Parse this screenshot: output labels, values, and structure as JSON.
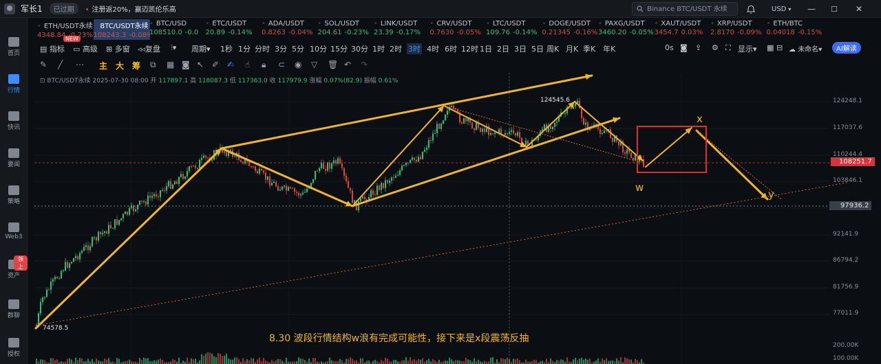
{
  "titlebar": {
    "user_name": "军长1",
    "status_badge": "已过期",
    "promo_text": "注册返20%，赢迈凯伦乐高",
    "search_placeholder": "Binance BTC/USDT 永续",
    "currency": "USD"
  },
  "sidebar": {
    "items": [
      {
        "label": "首页"
      },
      {
        "label": "行情"
      },
      {
        "label": "快讯"
      },
      {
        "label": "要闻"
      },
      {
        "label": "策略"
      },
      {
        "label": "Web3"
      },
      {
        "label": "资产",
        "badge": "领上"
      },
      {
        "label": "群聊"
      },
      {
        "label": "授权"
      }
    ]
  },
  "tickers": [
    {
      "pair": "ETH/USDT永续",
      "price": "4348.84",
      "change": "-0.23%",
      "dir": "down"
    },
    {
      "pair": "BTC/USDT永续",
      "price": "108243.3",
      "change": "-0.08%",
      "dir": "down",
      "active": true
    },
    {
      "pair": "BTC/USD",
      "price": "108510.0",
      "change": "-0.0",
      "dir": "up"
    },
    {
      "pair": "ETC/USDT",
      "price": "20.89",
      "change": "-0.14%",
      "dir": "up"
    },
    {
      "pair": "ADA/USDT",
      "price": "0.8263",
      "change": "-0.04%",
      "dir": "down"
    },
    {
      "pair": "SOL/USDT",
      "price": "204.61",
      "change": "-0.23%",
      "dir": "up"
    },
    {
      "pair": "LINK/USDT",
      "price": "23.39",
      "change": "-0.17%",
      "dir": "up"
    },
    {
      "pair": "CRV/USDT",
      "price": "0.7630",
      "change": "-0.05%",
      "dir": "down"
    },
    {
      "pair": "LTC/USDT",
      "price": "109.76",
      "change": "-0.14%",
      "dir": "up"
    },
    {
      "pair": "DOGE/USDT",
      "price": "0.21345",
      "change": "-0.16%",
      "dir": "down"
    },
    {
      "pair": "PAXG/USDT",
      "price": "3460.20",
      "change": "-0.05%",
      "dir": "up"
    },
    {
      "pair": "XAUT/USDT",
      "price": "3454.7",
      "change": "0.03%",
      "dir": "down"
    },
    {
      "pair": "XRP/USDT",
      "price": "2.8170",
      "change": "-0.09%",
      "dir": "down"
    },
    {
      "pair": "ETH/BTC",
      "price": "0.04018",
      "change": "-0.15%",
      "dir": "down"
    }
  ],
  "new_badge": "NEW",
  "toolbar": {
    "left": [
      "指标",
      "高级",
      "多窗",
      "复盘"
    ],
    "period_label": "周期",
    "timeframes": [
      "1秒",
      "1分",
      "分时",
      "3分",
      "5分",
      "10分",
      "15分",
      "30分",
      "1时",
      "2时",
      "3时",
      "4时",
      "6时",
      "12时",
      "1日",
      "2日",
      "3日",
      "5日",
      "周K",
      "月K",
      "季K",
      "年K"
    ],
    "active_timeframe": "3时",
    "seconds": "0s",
    "display_label": "显示",
    "unnamed_label": "未命名",
    "ai_label": "AI解读"
  },
  "drawbar": {
    "gold_tools": [
      "主",
      "大",
      "筹"
    ]
  },
  "chart_info": {
    "symbol": "BTC/USDT永续",
    "date": "2025-07-30 08:00",
    "open_label": "开",
    "open": "117897.1",
    "high_label": "高",
    "high": "118087.3",
    "low_label": "低",
    "low": "117363.0",
    "close_label": "收",
    "close": "117979.9",
    "change_label": "涨幅",
    "change": "0.07%(82.9)",
    "amp_label": "振幅",
    "amp": "0.61%"
  },
  "chart_data": {
    "type": "line",
    "price_axis_ticks": [
      "124248.1",
      "117037.6",
      "110244.4",
      "103846.1",
      "97936.2",
      "92141.9",
      "86794.2",
      "81756.9",
      "77011.9",
      "200.00K",
      "100.00K"
    ],
    "current_price": "108251.7",
    "crosshair_price": "97936.2",
    "high_label": "124545.6",
    "low_label": "74578.5",
    "wave_labels": [
      "w",
      "x",
      "y"
    ],
    "annotation": "8.30 波段行情结构w浪有完成可能性，接下来是x段震荡反抽",
    "colors": {
      "up": "#27c47a",
      "down": "#e04545",
      "drawing": "#f0b52e",
      "box": "#e02d2d",
      "accent": "#3d8bff"
    }
  }
}
